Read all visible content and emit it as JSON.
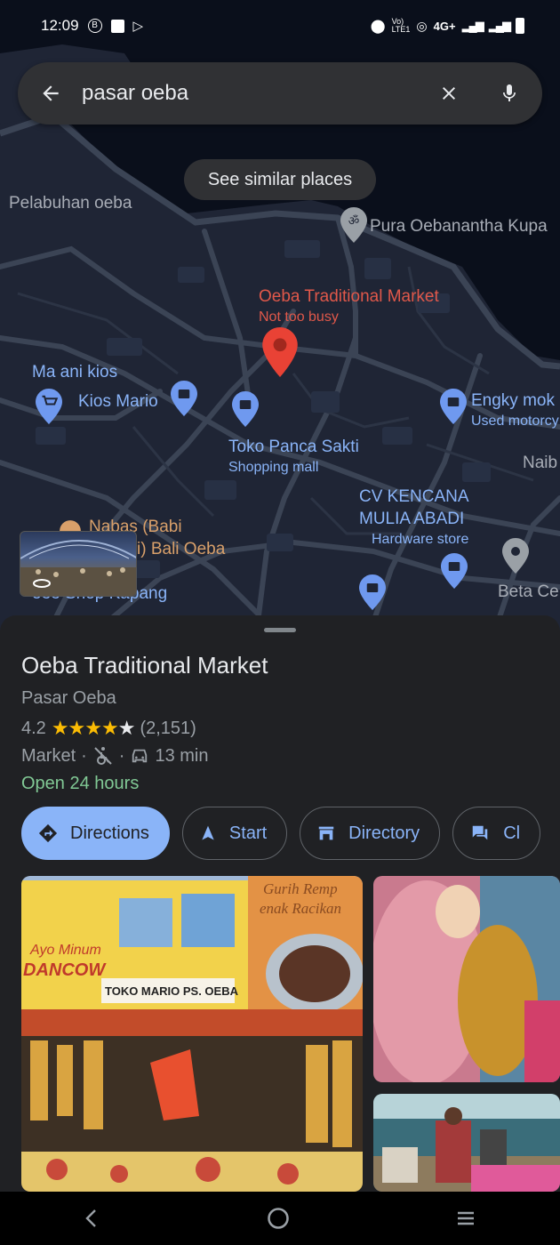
{
  "status_bar": {
    "time": "12:09",
    "icons": [
      "b-circle-icon",
      "news-icon",
      "play-store-icon"
    ],
    "right_icons": [
      "location-icon",
      "volte-icon",
      "hotspot-icon",
      "signal-icon",
      "battery-icon"
    ],
    "network": "4G+"
  },
  "search": {
    "query": "pasar oeba"
  },
  "chip": {
    "label": "See similar places"
  },
  "map": {
    "labels": {
      "pelabuhan": "Pelabuhan oeba",
      "pura": "Pura Oebanantha Kupa",
      "market_name": "Oeba Traditional Market",
      "market_busy": "Not too busy",
      "maani": "Ma ani kios",
      "kios_mario": "Kios Mario",
      "engky": "Engky mok",
      "engky_sub": "Used motorcy",
      "toko_panca": "Toko Panca Sakti",
      "toko_panca_sub": "Shopping mall",
      "naib": "Naib",
      "cv_kencana_1": "CV KENCANA",
      "cv_kencana_2": "MULIA ABADI",
      "cv_kencana_sub": "Hardware store",
      "nabas_1": "Nabas (Babi",
      "nabas_2": "i) Bali Oeba",
      "shop_kapang": "oee Shop Kapang",
      "beta": "Beta Ce"
    },
    "colors": {
      "land": "#1f2535",
      "water": "#0a0f1b",
      "road": "#3b4455",
      "pin_red": "#e94235",
      "poi_blue": "#6f99ef"
    }
  },
  "place": {
    "title": "Oeba Traditional Market",
    "subtitle": "Pasar Oeba",
    "rating": "4.2",
    "reviews": "(2,151)",
    "category": "Market",
    "drive_time": "13 min",
    "hours": "Open 24 hours"
  },
  "actions": [
    {
      "label": "Directions",
      "icon": "directions-icon"
    },
    {
      "label": "Start",
      "icon": "navigation-arrow-icon"
    },
    {
      "label": "Directory",
      "icon": "store-icon"
    },
    {
      "label": "Cl",
      "icon": "chat-icon"
    }
  ],
  "photos": {
    "main_sign_text_1": "Ayo Minum",
    "main_sign_text_2": "DANCOW",
    "main_sign_text_3": "TOKO MARIO PS. OEBA",
    "main_sign_text_4": "Gurih Remp",
    "main_sign_text_5": "enak Racikan"
  }
}
